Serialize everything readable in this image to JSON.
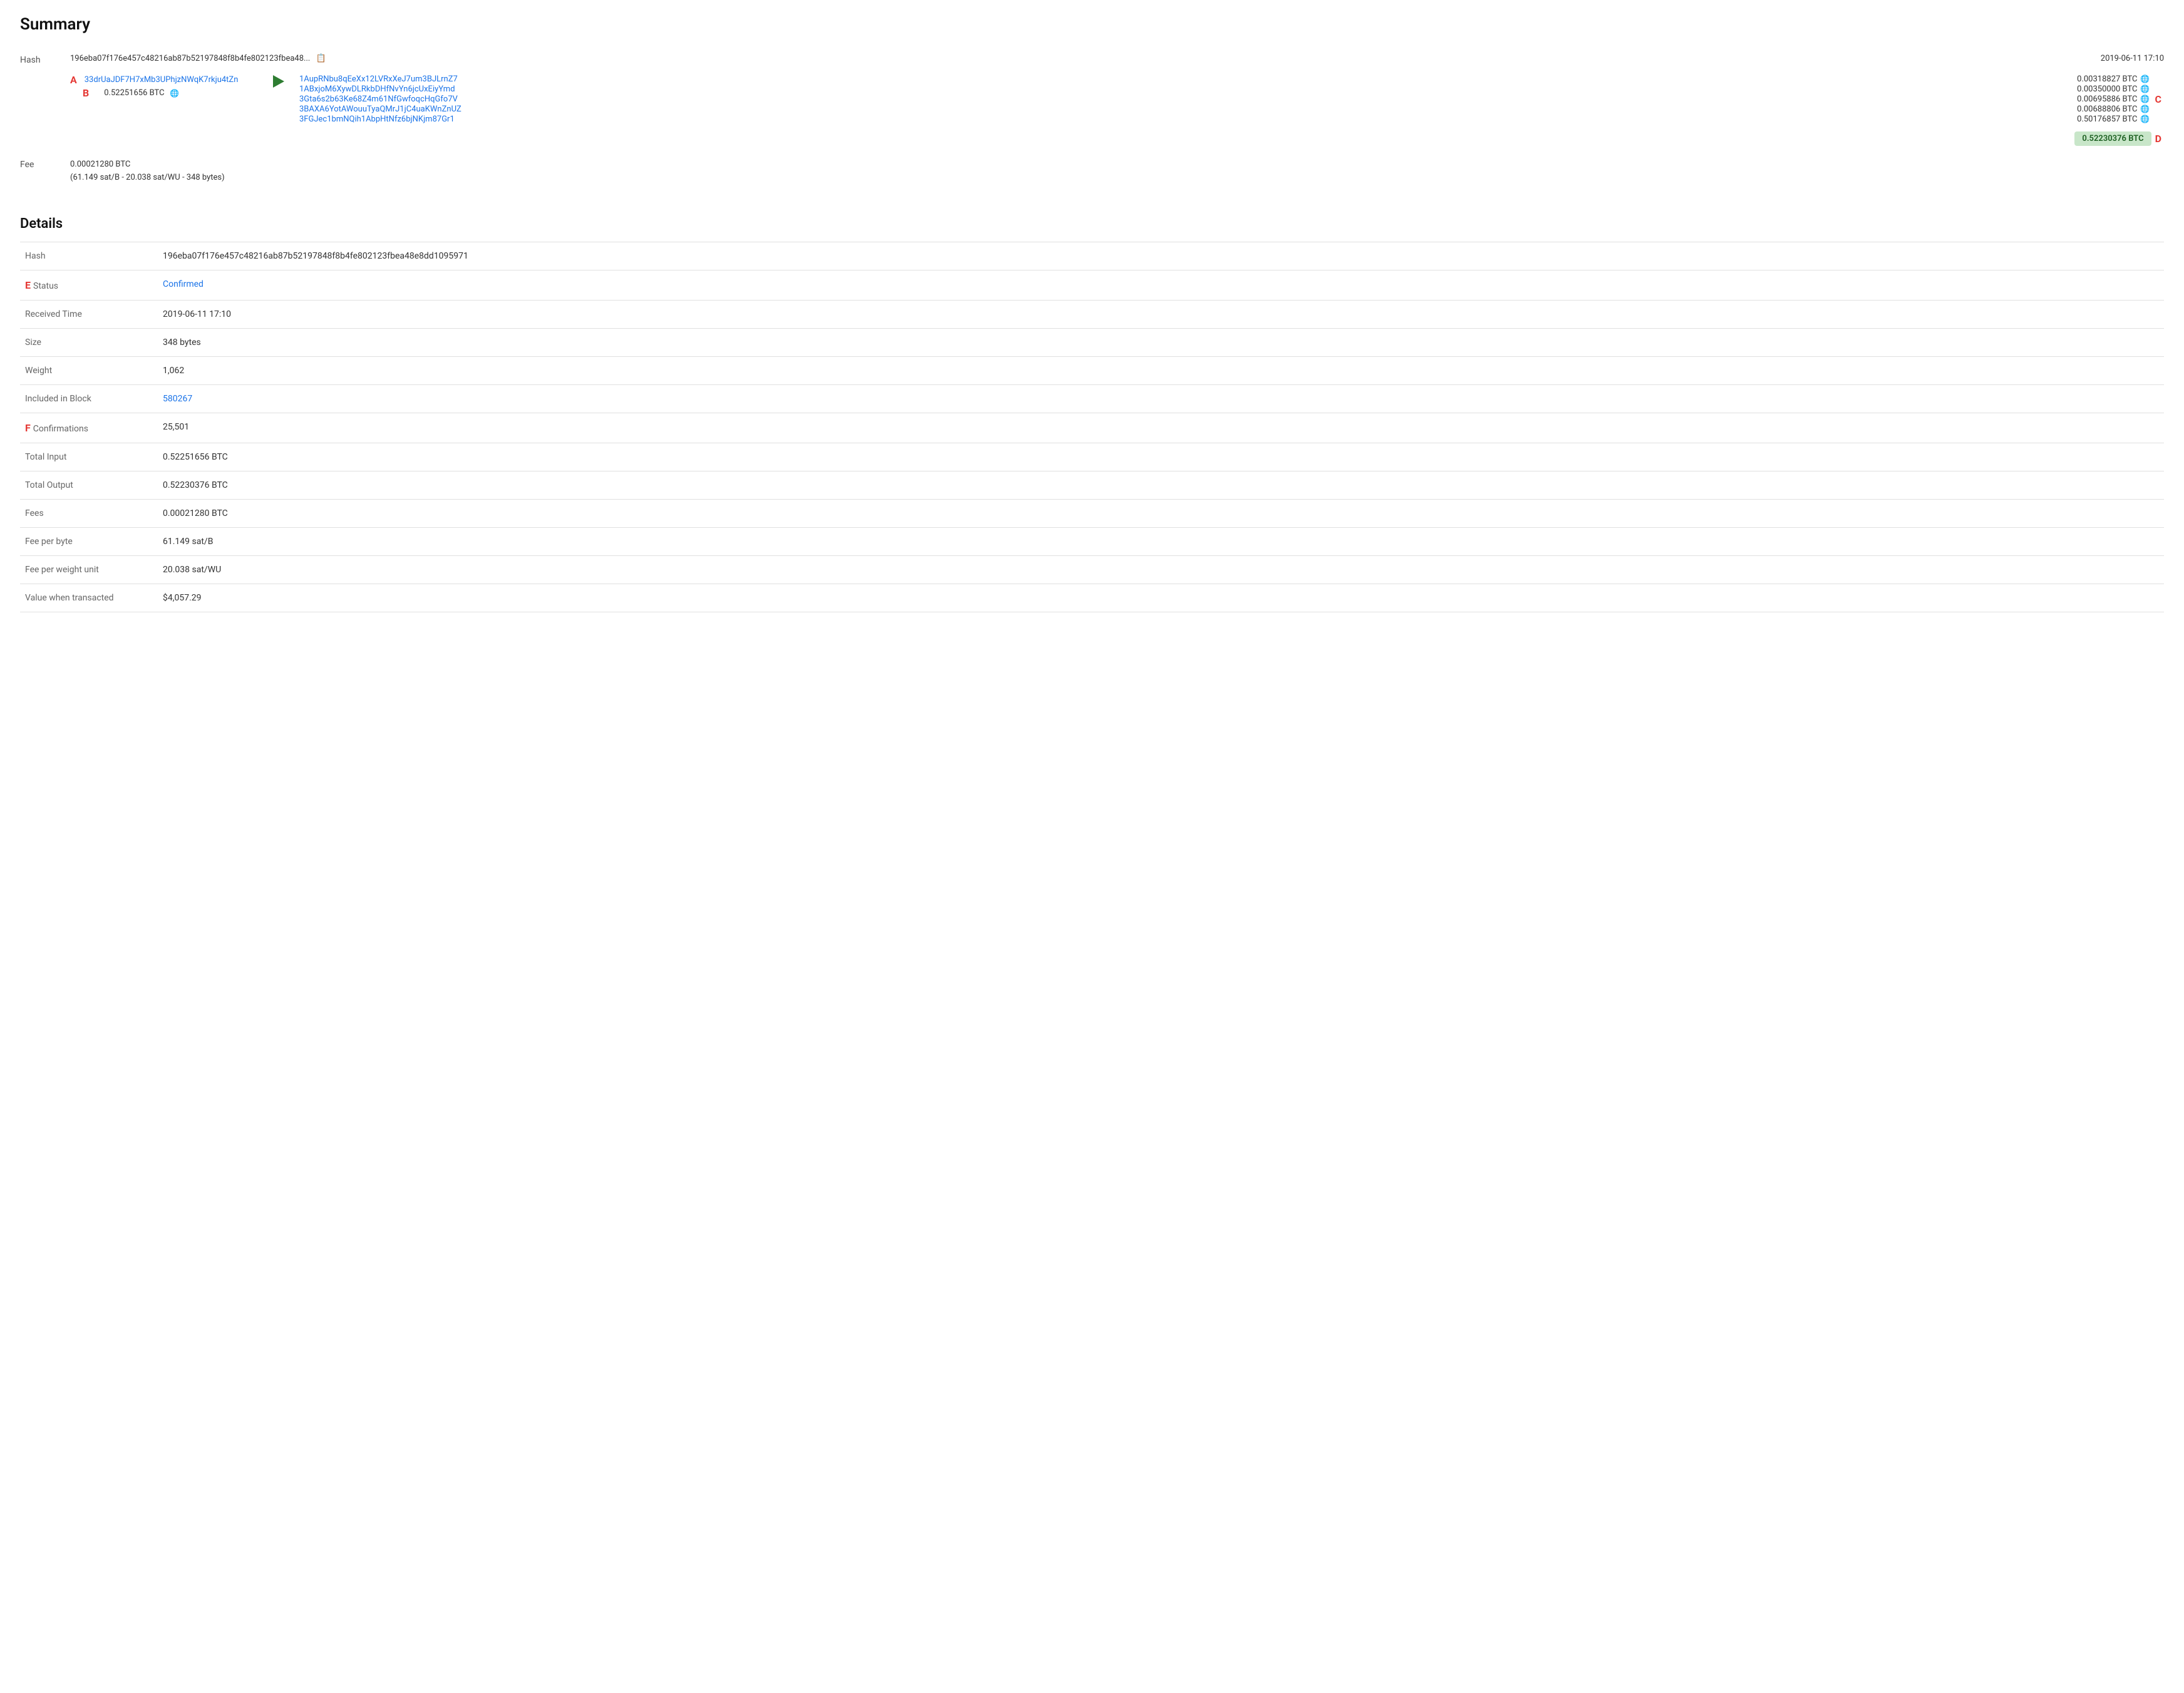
{
  "summary": {
    "title": "Summary",
    "hash_label": "Hash",
    "hash_value": "196eba07f176e457c48216ab87b52197848f8b4fe802123fbea48...",
    "hash_full": "196eba07f176e457c48216ab87b52197848f8b4fe802123fbea48e8dd1095971",
    "date": "2019-06-11 17:10",
    "input": {
      "address": "33drUaJDF7H7xMb3UPhjzNWqK7rkju4tZn",
      "amount": "0.52251656 BTC"
    },
    "outputs": [
      {
        "address": "1AupRNbu8qEeXx12LVRxXeJ7um3BJLrnZ7",
        "amount": "0.00318827 BTC"
      },
      {
        "address": "1ABxjoM6XywDLRkbDHfNvYn6jcUxEiyYmd",
        "amount": "0.00350000 BTC"
      },
      {
        "address": "3Gta6s2b63Ke68Z4m61NfGwfoqcHqGfo7V",
        "amount": "0.00695886 BTC"
      },
      {
        "address": "3BAXA6YotAWouuTyaQMrJ1jC4uaKWnZnUZ",
        "amount": "0.00688806 BTC"
      },
      {
        "address": "3FGJec1bmNQih1AbpHtNfz6bjNKjm87Gr1",
        "amount": "0.50176857 BTC"
      }
    ],
    "total_output": "0.52230376 BTC",
    "fee_label": "Fee",
    "fee_value": "0.00021280 BTC",
    "fee_detail": "(61.149 sat/B - 20.038 sat/WU - 348 bytes)"
  },
  "details": {
    "title": "Details",
    "rows": [
      {
        "label": "Hash",
        "value": "196eba07f176e457c48216ab87b52197848f8b4fe802123fbea48e8dd1095971",
        "type": "text"
      },
      {
        "label": "Status",
        "value": "Confirmed",
        "type": "status"
      },
      {
        "label": "Received Time",
        "value": "2019-06-11 17:10",
        "type": "text"
      },
      {
        "label": "Size",
        "value": "348 bytes",
        "type": "text"
      },
      {
        "label": "Weight",
        "value": "1,062",
        "type": "text"
      },
      {
        "label": "Included in Block",
        "value": "580267",
        "type": "link"
      },
      {
        "label": "Confirmations",
        "value": "25,501",
        "type": "text"
      },
      {
        "label": "Total Input",
        "value": "0.52251656 BTC",
        "type": "text"
      },
      {
        "label": "Total Output",
        "value": "0.52230376 BTC",
        "type": "text"
      },
      {
        "label": "Fees",
        "value": "0.00021280 BTC",
        "type": "text"
      },
      {
        "label": "Fee per byte",
        "value": "61.149 sat/B",
        "type": "text"
      },
      {
        "label": "Fee per weight unit",
        "value": "20.038 sat/WU",
        "type": "text"
      },
      {
        "label": "Value when transacted",
        "value": "$4,057.29",
        "type": "text"
      }
    ]
  },
  "annotations": {
    "A": "A",
    "B": "B",
    "C": "C",
    "D": "D",
    "E": "E",
    "F": "F"
  }
}
